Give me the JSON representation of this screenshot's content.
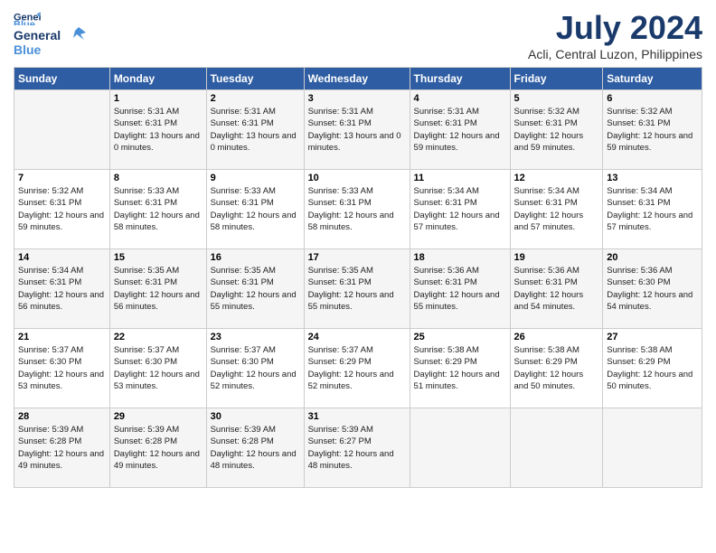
{
  "header": {
    "logo_general": "General",
    "logo_blue": "Blue",
    "title": "July 2024",
    "location": "Acli, Central Luzon, Philippines"
  },
  "weekdays": [
    "Sunday",
    "Monday",
    "Tuesday",
    "Wednesday",
    "Thursday",
    "Friday",
    "Saturday"
  ],
  "rows": [
    [
      {
        "day": "",
        "sunrise": "",
        "sunset": "",
        "daylight": ""
      },
      {
        "day": "1",
        "sunrise": "Sunrise: 5:31 AM",
        "sunset": "Sunset: 6:31 PM",
        "daylight": "Daylight: 13 hours and 0 minutes."
      },
      {
        "day": "2",
        "sunrise": "Sunrise: 5:31 AM",
        "sunset": "Sunset: 6:31 PM",
        "daylight": "Daylight: 13 hours and 0 minutes."
      },
      {
        "day": "3",
        "sunrise": "Sunrise: 5:31 AM",
        "sunset": "Sunset: 6:31 PM",
        "daylight": "Daylight: 13 hours and 0 minutes."
      },
      {
        "day": "4",
        "sunrise": "Sunrise: 5:31 AM",
        "sunset": "Sunset: 6:31 PM",
        "daylight": "Daylight: 12 hours and 59 minutes."
      },
      {
        "day": "5",
        "sunrise": "Sunrise: 5:32 AM",
        "sunset": "Sunset: 6:31 PM",
        "daylight": "Daylight: 12 hours and 59 minutes."
      },
      {
        "day": "6",
        "sunrise": "Sunrise: 5:32 AM",
        "sunset": "Sunset: 6:31 PM",
        "daylight": "Daylight: 12 hours and 59 minutes."
      }
    ],
    [
      {
        "day": "7",
        "sunrise": "Sunrise: 5:32 AM",
        "sunset": "Sunset: 6:31 PM",
        "daylight": "Daylight: 12 hours and 59 minutes."
      },
      {
        "day": "8",
        "sunrise": "Sunrise: 5:33 AM",
        "sunset": "Sunset: 6:31 PM",
        "daylight": "Daylight: 12 hours and 58 minutes."
      },
      {
        "day": "9",
        "sunrise": "Sunrise: 5:33 AM",
        "sunset": "Sunset: 6:31 PM",
        "daylight": "Daylight: 12 hours and 58 minutes."
      },
      {
        "day": "10",
        "sunrise": "Sunrise: 5:33 AM",
        "sunset": "Sunset: 6:31 PM",
        "daylight": "Daylight: 12 hours and 58 minutes."
      },
      {
        "day": "11",
        "sunrise": "Sunrise: 5:34 AM",
        "sunset": "Sunset: 6:31 PM",
        "daylight": "Daylight: 12 hours and 57 minutes."
      },
      {
        "day": "12",
        "sunrise": "Sunrise: 5:34 AM",
        "sunset": "Sunset: 6:31 PM",
        "daylight": "Daylight: 12 hours and 57 minutes."
      },
      {
        "day": "13",
        "sunrise": "Sunrise: 5:34 AM",
        "sunset": "Sunset: 6:31 PM",
        "daylight": "Daylight: 12 hours and 57 minutes."
      }
    ],
    [
      {
        "day": "14",
        "sunrise": "Sunrise: 5:34 AM",
        "sunset": "Sunset: 6:31 PM",
        "daylight": "Daylight: 12 hours and 56 minutes."
      },
      {
        "day": "15",
        "sunrise": "Sunrise: 5:35 AM",
        "sunset": "Sunset: 6:31 PM",
        "daylight": "Daylight: 12 hours and 56 minutes."
      },
      {
        "day": "16",
        "sunrise": "Sunrise: 5:35 AM",
        "sunset": "Sunset: 6:31 PM",
        "daylight": "Daylight: 12 hours and 55 minutes."
      },
      {
        "day": "17",
        "sunrise": "Sunrise: 5:35 AM",
        "sunset": "Sunset: 6:31 PM",
        "daylight": "Daylight: 12 hours and 55 minutes."
      },
      {
        "day": "18",
        "sunrise": "Sunrise: 5:36 AM",
        "sunset": "Sunset: 6:31 PM",
        "daylight": "Daylight: 12 hours and 55 minutes."
      },
      {
        "day": "19",
        "sunrise": "Sunrise: 5:36 AM",
        "sunset": "Sunset: 6:31 PM",
        "daylight": "Daylight: 12 hours and 54 minutes."
      },
      {
        "day": "20",
        "sunrise": "Sunrise: 5:36 AM",
        "sunset": "Sunset: 6:30 PM",
        "daylight": "Daylight: 12 hours and 54 minutes."
      }
    ],
    [
      {
        "day": "21",
        "sunrise": "Sunrise: 5:37 AM",
        "sunset": "Sunset: 6:30 PM",
        "daylight": "Daylight: 12 hours and 53 minutes."
      },
      {
        "day": "22",
        "sunrise": "Sunrise: 5:37 AM",
        "sunset": "Sunset: 6:30 PM",
        "daylight": "Daylight: 12 hours and 53 minutes."
      },
      {
        "day": "23",
        "sunrise": "Sunrise: 5:37 AM",
        "sunset": "Sunset: 6:30 PM",
        "daylight": "Daylight: 12 hours and 52 minutes."
      },
      {
        "day": "24",
        "sunrise": "Sunrise: 5:37 AM",
        "sunset": "Sunset: 6:29 PM",
        "daylight": "Daylight: 12 hours and 52 minutes."
      },
      {
        "day": "25",
        "sunrise": "Sunrise: 5:38 AM",
        "sunset": "Sunset: 6:29 PM",
        "daylight": "Daylight: 12 hours and 51 minutes."
      },
      {
        "day": "26",
        "sunrise": "Sunrise: 5:38 AM",
        "sunset": "Sunset: 6:29 PM",
        "daylight": "Daylight: 12 hours and 50 minutes."
      },
      {
        "day": "27",
        "sunrise": "Sunrise: 5:38 AM",
        "sunset": "Sunset: 6:29 PM",
        "daylight": "Daylight: 12 hours and 50 minutes."
      }
    ],
    [
      {
        "day": "28",
        "sunrise": "Sunrise: 5:39 AM",
        "sunset": "Sunset: 6:28 PM",
        "daylight": "Daylight: 12 hours and 49 minutes."
      },
      {
        "day": "29",
        "sunrise": "Sunrise: 5:39 AM",
        "sunset": "Sunset: 6:28 PM",
        "daylight": "Daylight: 12 hours and 49 minutes."
      },
      {
        "day": "30",
        "sunrise": "Sunrise: 5:39 AM",
        "sunset": "Sunset: 6:28 PM",
        "daylight": "Daylight: 12 hours and 48 minutes."
      },
      {
        "day": "31",
        "sunrise": "Sunrise: 5:39 AM",
        "sunset": "Sunset: 6:27 PM",
        "daylight": "Daylight: 12 hours and 48 minutes."
      },
      {
        "day": "",
        "sunrise": "",
        "sunset": "",
        "daylight": ""
      },
      {
        "day": "",
        "sunrise": "",
        "sunset": "",
        "daylight": ""
      },
      {
        "day": "",
        "sunrise": "",
        "sunset": "",
        "daylight": ""
      }
    ]
  ]
}
